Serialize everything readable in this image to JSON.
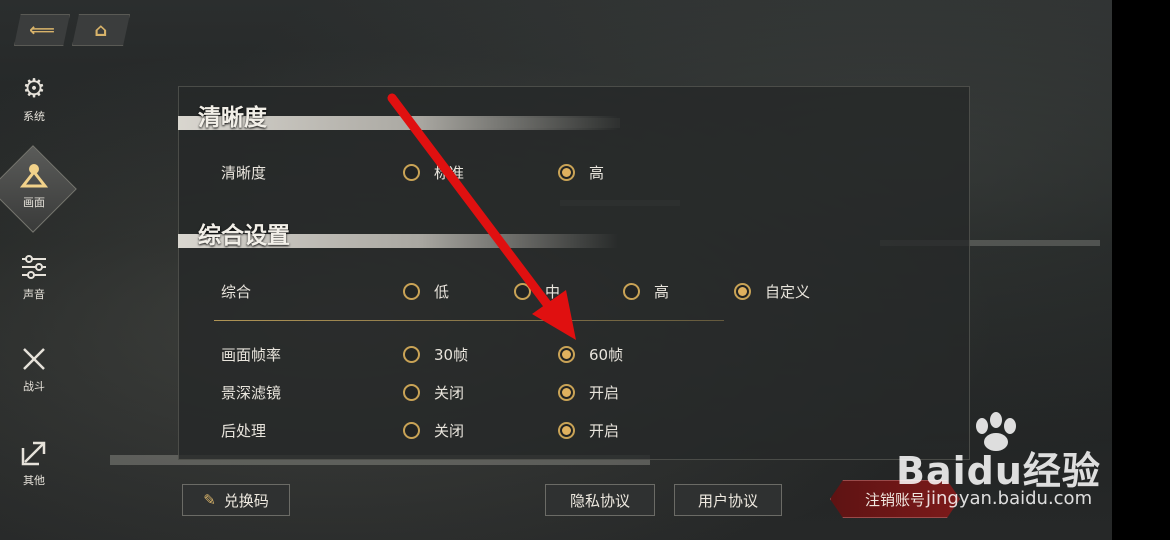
{
  "nav": {
    "back_icon": "back-arrow-icon",
    "home_icon": "home-icon"
  },
  "sidebar": {
    "items": [
      {
        "label": "系统",
        "icon": "gear-icon"
      },
      {
        "label": "画面",
        "icon": "graphics-icon",
        "active": true
      },
      {
        "label": "声音",
        "icon": "sliders-icon"
      },
      {
        "label": "战斗",
        "icon": "crossed-swords-icon"
      },
      {
        "label": "其他",
        "icon": "expand-arrow-icon"
      }
    ]
  },
  "sections": {
    "clarity": {
      "title": "清晰度",
      "rows": [
        {
          "label": "清晰度",
          "options": [
            "标准",
            "高"
          ],
          "selected": "高"
        }
      ]
    },
    "general": {
      "title": "综合设置",
      "preset": {
        "label": "综合",
        "options": [
          "低",
          "中",
          "高",
          "自定义"
        ],
        "selected": "自定义"
      },
      "rows": [
        {
          "label": "画面帧率",
          "options": [
            "30帧",
            "60帧"
          ],
          "selected": "60帧"
        },
        {
          "label": "景深滤镜",
          "options": [
            "关闭",
            "开启"
          ],
          "selected": "开启"
        },
        {
          "label": "后处理",
          "options": [
            "关闭",
            "开启"
          ],
          "selected": "开启"
        }
      ]
    }
  },
  "footer": {
    "redeem": "兑换码",
    "privacy": "隐私协议",
    "user_agreement": "用户协议",
    "logout": "注销账号"
  },
  "watermark": {
    "main": "Baidu经验",
    "sub": "jingyan.baidu.com"
  },
  "colors": {
    "accent": "#e0b15e",
    "annotation": "#e01010",
    "danger": "#7c1a1a"
  }
}
